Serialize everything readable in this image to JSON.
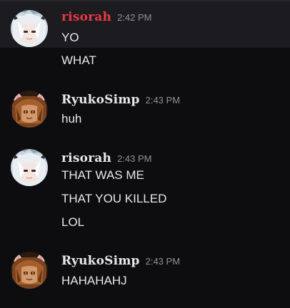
{
  "colors": {
    "background": "#0d0d10",
    "highlight": "#1b1b20",
    "risorah_name": "#e83a44",
    "ryuko_name": "#e8e8ea",
    "message_text": "#e6e7ea",
    "timestamp": "#8f9197"
  },
  "messages": [
    {
      "author": "risorah",
      "author_color": "#e83a44",
      "avatar_icon": "white-haired-anime-avatar-icon",
      "timestamp": "2:42 PM",
      "lines": [
        "YO",
        "WHAT"
      ]
    },
    {
      "author": "RyukoSimp",
      "author_color": "#e8e8ea",
      "avatar_icon": "cat-ear-anime-avatar-icon",
      "timestamp": "2:43 PM",
      "lines": [
        "huh"
      ]
    },
    {
      "author": "risorah",
      "author_color": "#e8e8ea",
      "avatar_icon": "white-haired-anime-avatar-icon",
      "timestamp": "2:43 PM",
      "lines": [
        "THAT WAS ME",
        "THAT YOU KILLED",
        "LOL"
      ]
    },
    {
      "author": "RyukoSimp",
      "author_color": "#e8e8ea",
      "avatar_icon": "cat-ear-anime-avatar-icon",
      "timestamp": "2:43 PM",
      "lines": [
        "HAHAHAHJ"
      ]
    }
  ]
}
